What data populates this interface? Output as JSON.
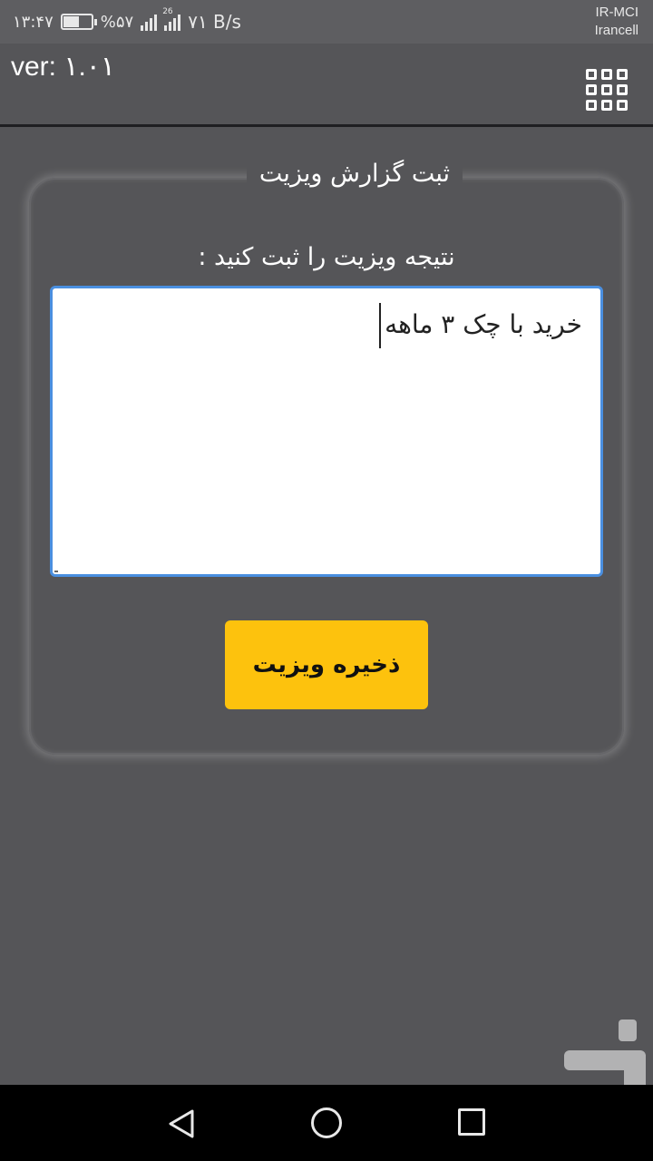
{
  "status_bar": {
    "time": "۱۳:۴۷",
    "battery": "%۵۷",
    "battery_level": 0.57,
    "network_type": "26",
    "speed": "۷۱ B/s",
    "carrier_1": "IR-MCI",
    "carrier_2": "Irancell"
  },
  "app_bar": {
    "version": "ver: ۱.۰۱",
    "menu_icon": "grid-icon"
  },
  "form": {
    "title": "ثبت گزارش ویزیت",
    "label": "نتیجه ویزیت را ثبت کنید :",
    "textarea_value": "خرید با چک ۳ ماهه",
    "save_label": "ذخیره ویزیت"
  },
  "colors": {
    "background": "#555558",
    "accent": "#fdc20d",
    "focus_border": "#4a8fe0"
  },
  "nav_bar": {
    "back_icon": "back-triangle-icon",
    "home_icon": "home-circle-icon",
    "recent_icon": "recent-square-icon"
  }
}
